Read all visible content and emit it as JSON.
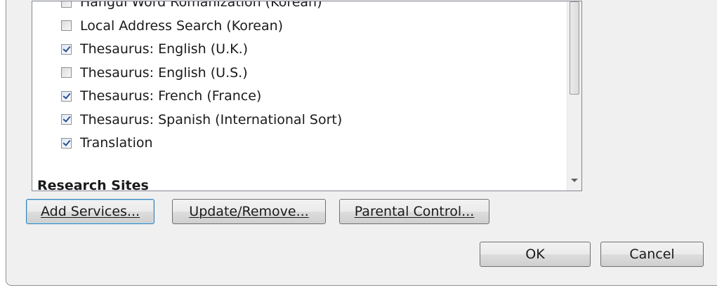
{
  "services": [
    {
      "label": "Hangul Word Romanization (Korean)",
      "checked": false
    },
    {
      "label": "Local Address Search (Korean)",
      "checked": false
    },
    {
      "label": "Thesaurus: English (U.K.)",
      "checked": true
    },
    {
      "label": "Thesaurus: English (U.S.)",
      "checked": false
    },
    {
      "label": "Thesaurus: French (France)",
      "checked": true
    },
    {
      "label": "Thesaurus: Spanish (International Sort)",
      "checked": true
    },
    {
      "label": "Translation",
      "checked": true
    }
  ],
  "group_header": "Research Sites",
  "buttons": {
    "add_services": "Add Services...",
    "update_remove": "Update/Remove...",
    "parental_control": "Parental Control...",
    "ok": "OK",
    "cancel": "Cancel"
  }
}
